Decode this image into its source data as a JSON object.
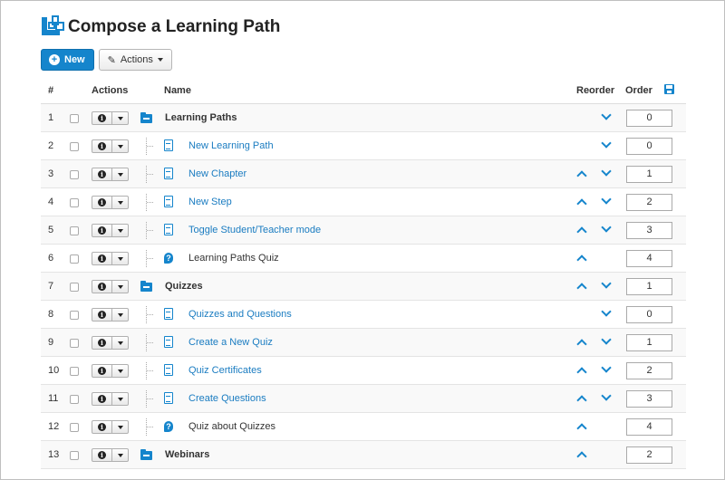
{
  "page": {
    "title": "Compose a Learning Path"
  },
  "toolbar": {
    "new_label": "New",
    "actions_label": "Actions"
  },
  "table": {
    "headers": {
      "num": "#",
      "actions": "Actions",
      "name": "Name",
      "reorder": "Reorder",
      "order": "Order"
    },
    "rows": [
      {
        "num": "1",
        "type": "folder",
        "name": "Learning Paths",
        "up": false,
        "down": true,
        "order": "0"
      },
      {
        "num": "2",
        "type": "doc",
        "name": "New Learning Path",
        "up": false,
        "down": true,
        "order": "0"
      },
      {
        "num": "3",
        "type": "doc",
        "name": "New Chapter",
        "up": true,
        "down": true,
        "order": "1"
      },
      {
        "num": "4",
        "type": "doc",
        "name": "New Step",
        "up": true,
        "down": true,
        "order": "2"
      },
      {
        "num": "5",
        "type": "doc",
        "name": "Toggle Student/Teacher mode",
        "up": true,
        "down": true,
        "order": "3"
      },
      {
        "num": "6",
        "type": "quiz",
        "name": "Learning Paths Quiz",
        "up": true,
        "down": false,
        "order": "4"
      },
      {
        "num": "7",
        "type": "folder",
        "name": "Quizzes",
        "up": true,
        "down": true,
        "order": "1"
      },
      {
        "num": "8",
        "type": "doc",
        "name": "Quizzes and Questions",
        "up": false,
        "down": true,
        "order": "0"
      },
      {
        "num": "9",
        "type": "doc",
        "name": "Create a New Quiz",
        "up": true,
        "down": true,
        "order": "1"
      },
      {
        "num": "10",
        "type": "doc",
        "name": "Quiz Certificates",
        "up": true,
        "down": true,
        "order": "2"
      },
      {
        "num": "11",
        "type": "doc",
        "name": "Create Questions",
        "up": true,
        "down": true,
        "order": "3"
      },
      {
        "num": "12",
        "type": "quiz",
        "name": "Quiz about Quizzes",
        "up": true,
        "down": false,
        "order": "4"
      },
      {
        "num": "13",
        "type": "folder",
        "name": "Webinars",
        "up": true,
        "down": false,
        "order": "2"
      }
    ]
  },
  "colors": {
    "accent": "#1585cc",
    "link": "#1a7cc1",
    "row_alt": "#f9f9f9"
  }
}
